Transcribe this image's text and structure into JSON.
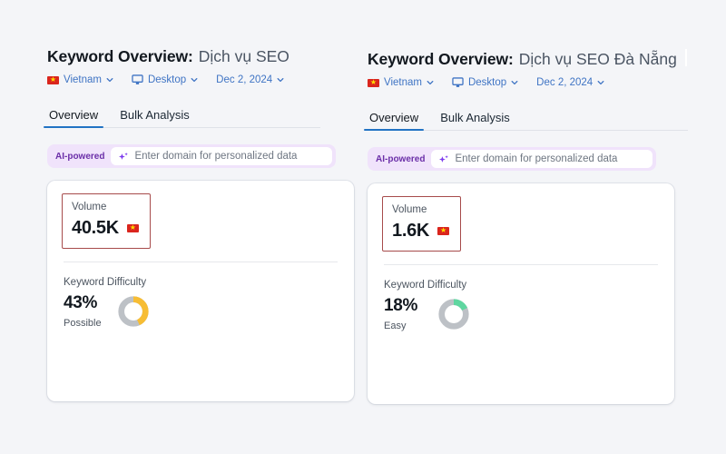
{
  "theme": {
    "page_background": "#f4f5f8",
    "accent_blue": "#2273c4",
    "link_blue": "#3f74c4",
    "ai_badge_bg": "#f0e3fb",
    "ai_badge_text": "#6b2fa8",
    "highlight_border": "#a74b4b",
    "donut_track": "#bdc1c6",
    "flag_red": "#da251d",
    "flag_star": "#ffdf00"
  },
  "panels": [
    {
      "header": {
        "title_label": "Keyword Overview:",
        "keyword": "Dịch vụ SEO",
        "has_caret": false
      },
      "filters": [
        {
          "name": "country",
          "icon": "vietnam-flag-icon",
          "label": "Vietnam"
        },
        {
          "name": "device",
          "icon": "monitor-icon",
          "label": "Desktop"
        },
        {
          "name": "date",
          "icon": null,
          "label": "Dec 2, 2024"
        }
      ],
      "tabs": [
        {
          "label": "Overview",
          "active": true
        },
        {
          "label": "Bulk Analysis",
          "active": false
        }
      ],
      "ai_bar": {
        "badge": "AI-powered",
        "icon": "sparkle-icon",
        "placeholder": "Enter domain for personalized data",
        "value": ""
      },
      "card": {
        "volume": {
          "label": "Volume",
          "value": "40.5K",
          "flag": "vietnam-flag-icon",
          "highlighted": true
        },
        "keyword_difficulty": {
          "label": "Keyword Difficulty",
          "percent_text": "43%",
          "percent": 43,
          "verdict": "Possible",
          "color": "#f7bd34"
        }
      }
    },
    {
      "header": {
        "title_label": "Keyword Overview:",
        "keyword": "Dịch vụ SEO Đà Nẵng",
        "has_caret": true
      },
      "filters": [
        {
          "name": "country",
          "icon": "vietnam-flag-icon",
          "label": "Vietnam"
        },
        {
          "name": "device",
          "icon": "monitor-icon",
          "label": "Desktop"
        },
        {
          "name": "date",
          "icon": null,
          "label": "Dec 2, 2024"
        }
      ],
      "tabs": [
        {
          "label": "Overview",
          "active": true
        },
        {
          "label": "Bulk Analysis",
          "active": false
        }
      ],
      "ai_bar": {
        "badge": "AI-powered",
        "icon": "sparkle-icon",
        "placeholder": "Enter domain for personalized data",
        "value": ""
      },
      "card": {
        "volume": {
          "label": "Volume",
          "value": "1.6K",
          "flag": "vietnam-flag-icon",
          "highlighted": true
        },
        "keyword_difficulty": {
          "label": "Keyword Difficulty",
          "percent_text": "18%",
          "percent": 18,
          "verdict": "Easy",
          "color": "#5fd6a0"
        }
      }
    }
  ]
}
